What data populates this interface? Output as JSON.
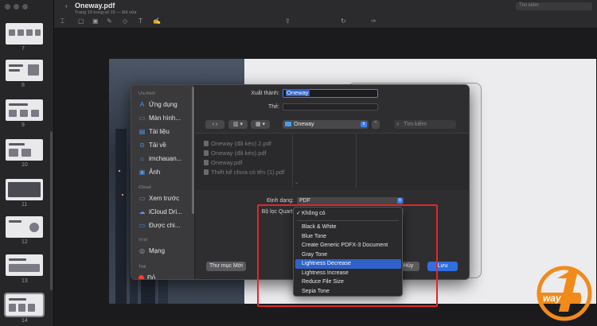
{
  "toolbar": {
    "doc_title": "Oneway.pdf",
    "doc_subtitle": "Trang 19 trong số 15 — Đã sửa",
    "search_placeholder": "Tìm kiếm"
  },
  "thumbnails": {
    "page_numbers": [
      "7",
      "8",
      "9",
      "10",
      "11",
      "12",
      "13",
      "14"
    ]
  },
  "dialog": {
    "sidebar": {
      "favorites_header": "Ưa thích",
      "favorites": [
        {
          "label": "Ứng dụng",
          "icon": "apps-icon"
        },
        {
          "label": "Màn hình...",
          "icon": "desktop-icon"
        },
        {
          "label": "Tài liệu",
          "icon": "document-icon"
        },
        {
          "label": "Tải về",
          "icon": "download-icon"
        },
        {
          "label": "imchauan...",
          "icon": "home-icon"
        },
        {
          "label": "Ảnh",
          "icon": "photos-icon"
        }
      ],
      "icloud_header": "iCloud",
      "icloud": [
        {
          "label": "Xem trước",
          "icon": "folder-icon"
        },
        {
          "label": "iCloud Dri...",
          "icon": "icloud-icon"
        },
        {
          "label": "Được chi...",
          "icon": "shared-folder-icon"
        }
      ],
      "locations_header": "Vị trí",
      "locations": [
        {
          "label": "Mạng",
          "icon": "network-icon"
        }
      ],
      "tags_header": "Thẻ",
      "tags": [
        {
          "label": "Đỏ",
          "color": "#ff3b30"
        }
      ]
    },
    "save_as_label": "Xuất thành:",
    "save_as_value": "Oneway",
    "tags_label": "Thẻ:",
    "location": "Oneway",
    "search_placeholder": "Tìm kiếm",
    "files": [
      "Oneway (đã kéo) 2.pdf",
      "Oneway (đã kéo).pdf",
      "Oneway.pdf",
      "Thiết kế chưa có tên (1).pdf"
    ],
    "format_label": "Định dạng:",
    "format_value": "PDF",
    "quartz_label": "Bộ lọc Quartz",
    "new_folder_button": "Thư mục Mới",
    "cancel_button": "Hủy",
    "save_button": "Lưu"
  },
  "quartz_menu": {
    "checked_item": "Không có",
    "items": [
      "Black & White",
      "Blue Tone",
      "Create Generic PDFX-3 Document",
      "Gray Tone",
      "Lightness Decrease",
      "Lightness Increase",
      "Reduce File Size",
      "Sepia Tone"
    ],
    "highlighted_index": 4
  },
  "colors": {
    "accent": "#2f6fe0",
    "highlight_box": "#e0262c",
    "logo_orange": "#f28a1a"
  }
}
